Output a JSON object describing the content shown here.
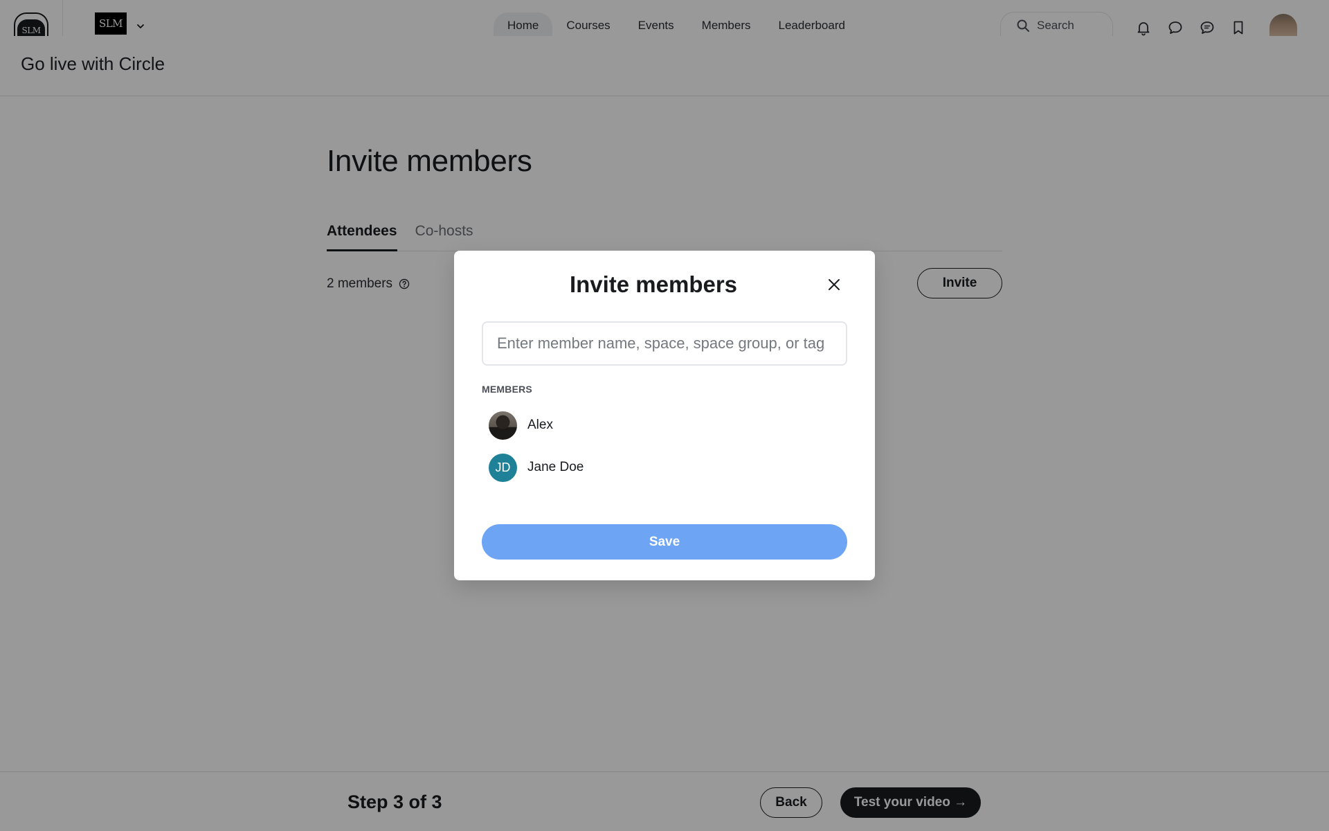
{
  "topbar": {
    "community_logo_text": "SLM",
    "brand_logo_text": "SLM",
    "nav": [
      {
        "label": "Home",
        "active": true
      },
      {
        "label": "Courses",
        "active": false
      },
      {
        "label": "Events",
        "active": false
      },
      {
        "label": "Members",
        "active": false
      },
      {
        "label": "Leaderboard",
        "active": false
      }
    ],
    "search_label": "Search",
    "icons": [
      "bell-icon",
      "chat-bubble-icon",
      "messages-icon",
      "bookmark-icon"
    ]
  },
  "page_header": {
    "title": "Go live with Circle"
  },
  "main": {
    "title": "Invite members",
    "tabs": [
      {
        "label": "Attendees",
        "active": true
      },
      {
        "label": "Co-hosts",
        "active": false
      }
    ],
    "members_count": "2 members",
    "invite_label": "Invite"
  },
  "footer": {
    "step_label": "Step 3 of 3",
    "back_label": "Back",
    "next_label": "Test your video →"
  },
  "modal": {
    "title": "Invite members",
    "input_placeholder": "Enter member name, space, space group, or tag",
    "input_value": "",
    "section_label": "MEMBERS",
    "members": [
      {
        "name": "Alex",
        "avatar": "photo"
      },
      {
        "name": "Jane Doe",
        "avatar": "initials",
        "initials": "JD"
      }
    ],
    "save_label": "Save"
  },
  "colors": {
    "primary_dark": "#191b1f",
    "save_button": "#6da4f4",
    "initials_avatar": "#1e8198",
    "overlay": "rgba(0,0,0,0.4)"
  }
}
